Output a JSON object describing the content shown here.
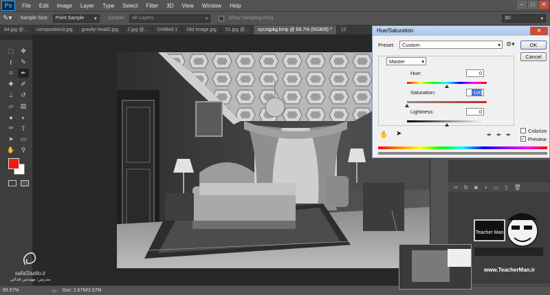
{
  "menubar": {
    "logo": "Ps",
    "items": [
      "File",
      "Edit",
      "Image",
      "Layer",
      "Type",
      "Select",
      "Filter",
      "3D",
      "View",
      "Window",
      "Help"
    ],
    "window_controls": [
      "–",
      "□",
      "✕"
    ]
  },
  "options": {
    "sample_size_label": "Sample Size:",
    "sample_size_value": "Point Sample",
    "sample_label": "Sample:",
    "sample_value": "All Layers",
    "sampling_ring_label": "Show Sampling Ring",
    "workspace_value": "3D"
  },
  "tabs": [
    {
      "label": "84.jpg @...",
      "active": false
    },
    {
      "label": "composition3.jpg",
      "active": false
    },
    {
      "label": "gravity-head2.jpg",
      "active": false
    },
    {
      "label": "2.jpg @...",
      "active": false
    },
    {
      "label": "Untitled-1",
      "active": false
    },
    {
      "label": "Old Image.jpg",
      "active": false
    },
    {
      "label": "51.jpg @...",
      "active": false
    },
    {
      "label": "xyczqpkg.bmp @ 66.7% (RGB/8) *",
      "active": true
    },
    {
      "label": "12",
      "active": false
    }
  ],
  "tools": [
    "move-icon",
    "artboard-icon",
    "marquee-icon",
    "lasso-icon",
    "quick-select-icon",
    "crop-icon",
    "eyedropper-icon",
    "healing-icon",
    "brush-icon",
    "stamp-icon",
    "history-brush-icon",
    "eraser-icon",
    "gradient-icon",
    "blur-icon",
    "dodge-icon",
    "pen-icon",
    "type-icon",
    "path-select-icon",
    "shape-icon",
    "hand-icon",
    "zoom-icon"
  ],
  "colors": {
    "foreground": "#ee1c10",
    "background": "#ffffff",
    "dialog_accent": "#3b6fd6"
  },
  "dialog": {
    "title": "Hue/Saturation",
    "close": "✕",
    "preset_label": "Preset:",
    "preset_value": "Custom",
    "channel_value": "Master",
    "hue_label": "Hue:",
    "hue_value": "0",
    "saturation_label": "Saturation:",
    "saturation_value": "-100",
    "lightness_label": "Lightness:",
    "lightness_value": "0",
    "ok_label": "OK",
    "cancel_label": "Cancel",
    "colorize_label": "Colorize",
    "colorize_checked": false,
    "preview_label": "Preview",
    "preview_checked": true
  },
  "status": {
    "zoom": "66.67%",
    "doc": "Doc: 2.67M/2.67M"
  },
  "watermark_left": {
    "site": "safaStudio.ir",
    "caption": "مدرس: مهندس فدائی"
  },
  "watermark_right": {
    "site": "www.TeacherMan.ir",
    "brand": "Teacher Man"
  }
}
